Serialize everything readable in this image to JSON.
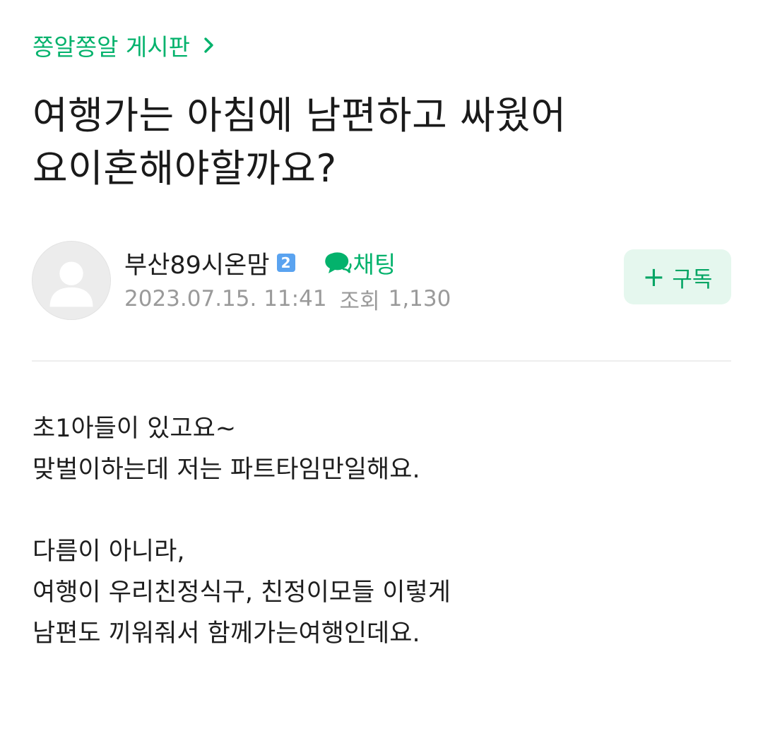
{
  "board": {
    "name": "쫑알쫑알 게시판",
    "chevron_icon": "chevron-right-icon",
    "color": "#03b26c"
  },
  "post": {
    "title_line1": "여행가는 아침에 남편하고 싸웠어",
    "title_line2": "요이혼해야할까요?"
  },
  "author": {
    "name": "부산89시온맘",
    "level": "2",
    "avatar_icon": "default-user-avatar-icon",
    "chat_label": "채팅",
    "chat_icon": "speech-bubble-icon"
  },
  "meta": {
    "datetime": "2023.07.15. 11:41",
    "views_label": "조회",
    "views_count": "1,130"
  },
  "subscribe": {
    "plus": "+",
    "label": "구독",
    "bg_color": "#e5f7ee",
    "text_color": "#03a564"
  },
  "content": {
    "lines": [
      "초1아들이 있고요~",
      "맞벌이하는데 저는 파트타임만일해요.",
      "",
      "다름이 아니라,",
      "여행이 우리친정식구, 친정이모들 이렇게",
      "남편도 끼워줘서 함께가는여행인데요."
    ]
  }
}
